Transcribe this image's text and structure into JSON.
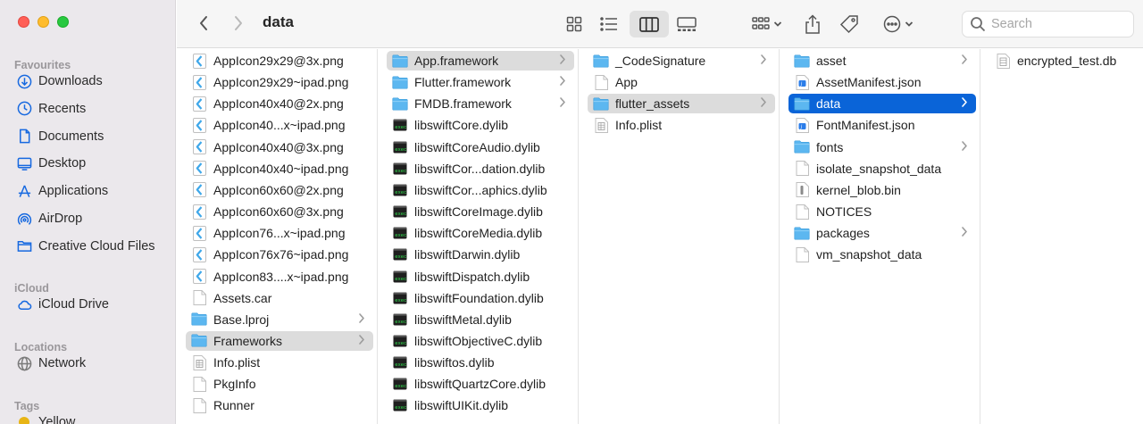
{
  "window": {
    "title": "data"
  },
  "colors": {
    "accent": "#0a64d8",
    "folder": "#5cb7f0",
    "sidebar_icon": "#1769e0"
  },
  "toolbar": {
    "back_icon": "chevron-left-icon",
    "forward_icon": "chevron-right-icon",
    "buttons": [
      "icon-view",
      "list-view",
      "column-view",
      "gallery-view",
      "group-menu",
      "share",
      "tags",
      "more-actions"
    ],
    "active_view": "column-view",
    "search_placeholder": "Search"
  },
  "sidebar": {
    "sections": [
      {
        "title": "Favourites",
        "items": [
          {
            "label": "Downloads",
            "icon": "download-icon"
          },
          {
            "label": "Recents",
            "icon": "clock-icon"
          },
          {
            "label": "Documents",
            "icon": "document-icon"
          },
          {
            "label": "Desktop",
            "icon": "desktop-icon"
          },
          {
            "label": "Applications",
            "icon": "applications-icon"
          },
          {
            "label": "AirDrop",
            "icon": "airdrop-icon"
          },
          {
            "label": "Creative Cloud Files",
            "icon": "folder-icon"
          }
        ]
      },
      {
        "title": "iCloud",
        "items": [
          {
            "label": "iCloud Drive",
            "icon": "cloud-icon"
          }
        ]
      },
      {
        "title": "Locations",
        "items": [
          {
            "label": "Network",
            "icon": "globe-icon"
          }
        ]
      },
      {
        "title": "Tags",
        "items": [
          {
            "label": "Yellow",
            "icon": "tag-dot-icon",
            "color": "#e8b515"
          }
        ]
      }
    ]
  },
  "columns": [
    {
      "items": [
        {
          "name": "AppIcon29x29@3x.png",
          "kind": "png"
        },
        {
          "name": "AppIcon29x29~ipad.png",
          "kind": "png"
        },
        {
          "name": "AppIcon40x40@2x.png",
          "kind": "png"
        },
        {
          "name": "AppIcon40...x~ipad.png",
          "kind": "png"
        },
        {
          "name": "AppIcon40x40@3x.png",
          "kind": "png"
        },
        {
          "name": "AppIcon40x40~ipad.png",
          "kind": "png"
        },
        {
          "name": "AppIcon60x60@2x.png",
          "kind": "png"
        },
        {
          "name": "AppIcon60x60@3x.png",
          "kind": "png"
        },
        {
          "name": "AppIcon76...x~ipad.png",
          "kind": "png"
        },
        {
          "name": "AppIcon76x76~ipad.png",
          "kind": "png"
        },
        {
          "name": "AppIcon83....x~ipad.png",
          "kind": "png"
        },
        {
          "name": "Assets.car",
          "kind": "file"
        },
        {
          "name": "Base.lproj",
          "kind": "folder",
          "expand": true
        },
        {
          "name": "Frameworks",
          "kind": "folder",
          "expand": true,
          "selected": "gray"
        },
        {
          "name": "Info.plist",
          "kind": "plist"
        },
        {
          "name": "PkgInfo",
          "kind": "file"
        },
        {
          "name": "Runner",
          "kind": "file"
        }
      ]
    },
    {
      "items": [
        {
          "name": "App.framework",
          "kind": "folder",
          "expand": true,
          "selected": "gray"
        },
        {
          "name": "Flutter.framework",
          "kind": "folder",
          "expand": true
        },
        {
          "name": "FMDB.framework",
          "kind": "folder",
          "expand": true
        },
        {
          "name": "libswiftCore.dylib",
          "kind": "exec"
        },
        {
          "name": "libswiftCoreAudio.dylib",
          "kind": "exec"
        },
        {
          "name": "libswiftCor...dation.dylib",
          "kind": "exec"
        },
        {
          "name": "libswiftCor...aphics.dylib",
          "kind": "exec"
        },
        {
          "name": "libswiftCoreImage.dylib",
          "kind": "exec"
        },
        {
          "name": "libswiftCoreMedia.dylib",
          "kind": "exec"
        },
        {
          "name": "libswiftDarwin.dylib",
          "kind": "exec"
        },
        {
          "name": "libswiftDispatch.dylib",
          "kind": "exec"
        },
        {
          "name": "libswiftFoundation.dylib",
          "kind": "exec"
        },
        {
          "name": "libswiftMetal.dylib",
          "kind": "exec"
        },
        {
          "name": "libswiftObjectiveC.dylib",
          "kind": "exec"
        },
        {
          "name": "libswiftos.dylib",
          "kind": "exec"
        },
        {
          "name": "libswiftQuartzCore.dylib",
          "kind": "exec"
        },
        {
          "name": "libswiftUIKit.dylib",
          "kind": "exec"
        }
      ]
    },
    {
      "items": [
        {
          "name": "_CodeSignature",
          "kind": "folder",
          "expand": true
        },
        {
          "name": "App",
          "kind": "file"
        },
        {
          "name": "flutter_assets",
          "kind": "folder",
          "expand": true,
          "selected": "gray"
        },
        {
          "name": "Info.plist",
          "kind": "plist"
        }
      ]
    },
    {
      "items": [
        {
          "name": "asset",
          "kind": "folder",
          "expand": true
        },
        {
          "name": "AssetManifest.json",
          "kind": "json"
        },
        {
          "name": "data",
          "kind": "folder",
          "expand": true,
          "selected": "blue"
        },
        {
          "name": "FontManifest.json",
          "kind": "json"
        },
        {
          "name": "fonts",
          "kind": "folder",
          "expand": true
        },
        {
          "name": "isolate_snapshot_data",
          "kind": "file"
        },
        {
          "name": "kernel_blob.bin",
          "kind": "bin"
        },
        {
          "name": "NOTICES",
          "kind": "file"
        },
        {
          "name": "packages",
          "kind": "folder",
          "expand": true
        },
        {
          "name": "vm_snapshot_data",
          "kind": "file"
        }
      ]
    },
    {
      "items": [
        {
          "name": "encrypted_test.db",
          "kind": "db"
        }
      ]
    }
  ]
}
